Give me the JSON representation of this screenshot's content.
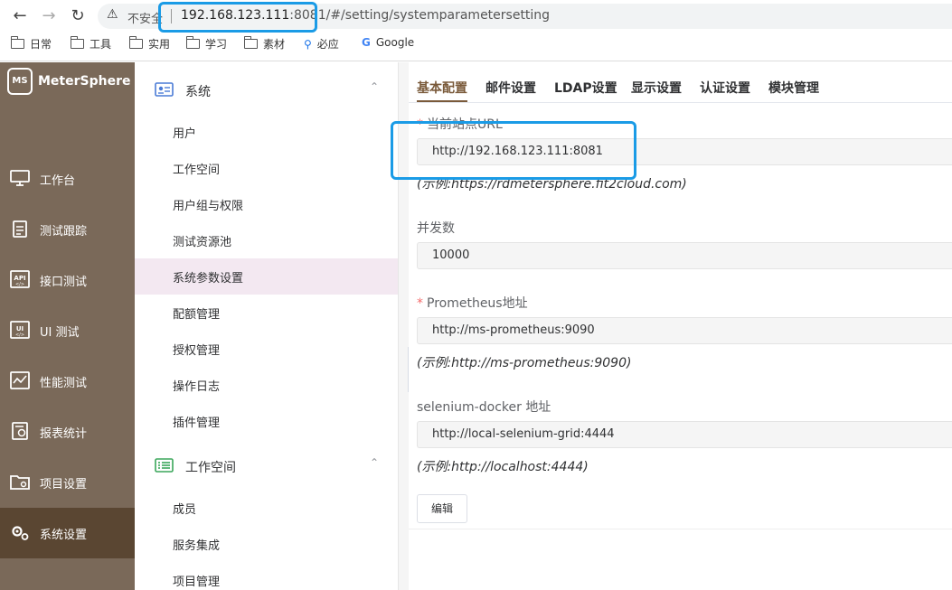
{
  "browser": {
    "back_icon": "arrow-left-icon",
    "forward_icon": "arrow-right-icon",
    "reload_icon": "reload-icon",
    "insecure_label": "不安全",
    "url_host": "192.168.123.111",
    "url_rest": ":8081/#/setting/systemparametersetting",
    "bookmarks": [
      "日常",
      "工具",
      "实用",
      "学习",
      "素材",
      "必应",
      "Google"
    ]
  },
  "app": {
    "logo_mark": "MS",
    "name": "MeterSphere"
  },
  "sidebar": {
    "items": [
      {
        "label": "工作台",
        "icon": "monitor-icon"
      },
      {
        "label": "测试跟踪",
        "icon": "clipboard-icon"
      },
      {
        "label": "接口测试",
        "icon": "api-icon"
      },
      {
        "label": "UI 测试",
        "icon": "ui-test-icon"
      },
      {
        "label": "性能测试",
        "icon": "performance-chart-icon"
      },
      {
        "label": "报表统计",
        "icon": "report-icon"
      },
      {
        "label": "项目设置",
        "icon": "folder-settings-icon"
      },
      {
        "label": "系统设置",
        "icon": "gears-icon"
      }
    ],
    "active_index": 7
  },
  "submenu": {
    "system_group": "系统",
    "system_items": [
      "用户",
      "工作空间",
      "用户组与权限",
      "测试资源池",
      "系统参数设置",
      "配额管理",
      "授权管理",
      "操作日志",
      "插件管理"
    ],
    "workspace_group": "工作空间",
    "workspace_items": [
      "成员",
      "服务集成",
      "项目管理"
    ]
  },
  "tabs": [
    "基本配置",
    "邮件设置",
    "LDAP设置",
    "显示设置",
    "认证设置",
    "模块管理"
  ],
  "form": {
    "site_url_label": "当前站点URL",
    "site_url_value": "http://192.168.123.111:8081",
    "site_url_hint": "(示例:https://rdmetersphere.fit2cloud.com)",
    "concurrency_label": "并发数",
    "concurrency_value": "10000",
    "prometheus_label": "Prometheus地址",
    "prometheus_value": "http://ms-prometheus:9090",
    "prometheus_hint": "(示例:http://ms-prometheus:9090)",
    "selenium_label": "selenium-docker 地址",
    "selenium_value": "http://local-selenium-grid:4444",
    "selenium_hint": "(示例:http://localhost:4444)",
    "required_mark": "*",
    "edit_button": "编辑"
  },
  "colors": {
    "sidebar_bg": "#7a6959",
    "sidebar_active": "#5a4632",
    "accent": "#7a5a3a",
    "highlight_box": "#1a9be6",
    "active_subitem_bg": "#f3e8f1"
  }
}
